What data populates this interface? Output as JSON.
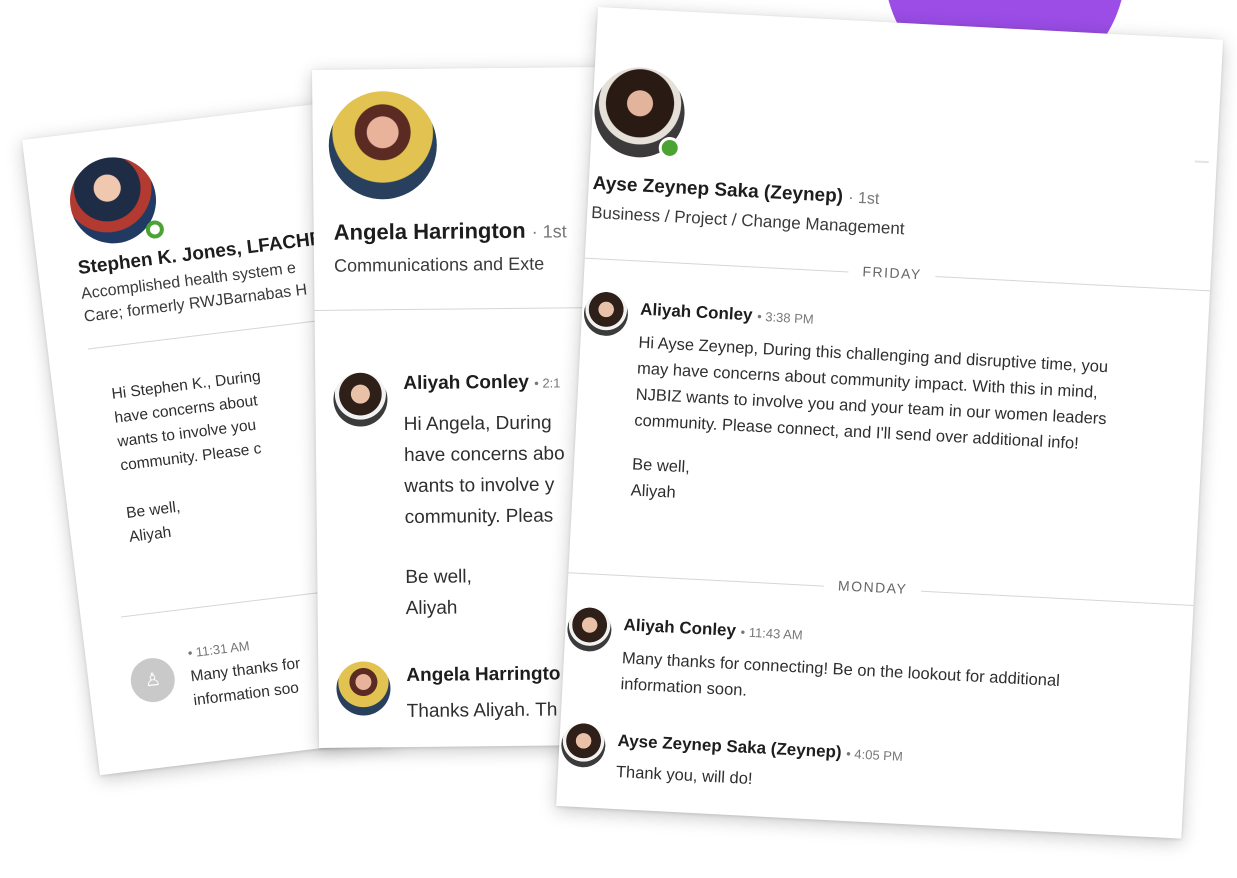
{
  "card_a": {
    "profile": {
      "name": "Stephen K. Jones, LFACHE",
      "headline_line1": "Accomplished health system e",
      "headline_line2": "Care; formerly RWJBarnabas H"
    },
    "message1": {
      "lines": [
        "Hi Stephen K., During",
        "have concerns about",
        "wants to involve you",
        "community. Please c",
        "",
        "Be well,",
        "Aliyah"
      ]
    },
    "message2": {
      "time": "• 11:31 AM",
      "lines": [
        "Many thanks for",
        "information soo"
      ]
    }
  },
  "card_b": {
    "profile": {
      "name": "Angela Harrington",
      "degree": "· 1st",
      "headline": "Communications and Exte"
    },
    "message1": {
      "sender": "Aliyah Conley",
      "time": "• 2:1",
      "lines": [
        "Hi Angela, During",
        "have concerns abo",
        "wants to involve y",
        "community. Pleas",
        "",
        "Be well,",
        "Aliyah"
      ]
    },
    "message2": {
      "sender": "Angela Harringto",
      "lines": [
        "Thanks Aliyah. Th"
      ]
    }
  },
  "card_c": {
    "profile": {
      "name": "Ayse Zeynep Saka (Zeynep)",
      "degree": "· 1st",
      "headline": "Business / Project / Change Management"
    },
    "day1": "FRIDAY",
    "message1": {
      "sender": "Aliyah Conley",
      "time": "• 3:38 PM",
      "lines": [
        "Hi Ayse Zeynep, During this challenging and disruptive time, you",
        "may have concerns about community impact. With this in mind,",
        "NJBIZ wants to involve you and your team in our women leaders",
        "community. Please connect, and I'll send over additional info!",
        "",
        "Be well,",
        "Aliyah"
      ]
    },
    "day2": "MONDAY",
    "message2": {
      "sender": "Aliyah Conley",
      "time": "• 11:43 AM",
      "lines": [
        "Many thanks for connecting! Be on the lookout for additional",
        "information soon."
      ]
    },
    "message3": {
      "sender": "Ayse Zeynep Saka (Zeynep)",
      "time": "• 4:05 PM",
      "lines": [
        "Thank you, will do!"
      ]
    }
  },
  "colors": {
    "accent": "#9b4de6",
    "online": "#4ba333"
  }
}
